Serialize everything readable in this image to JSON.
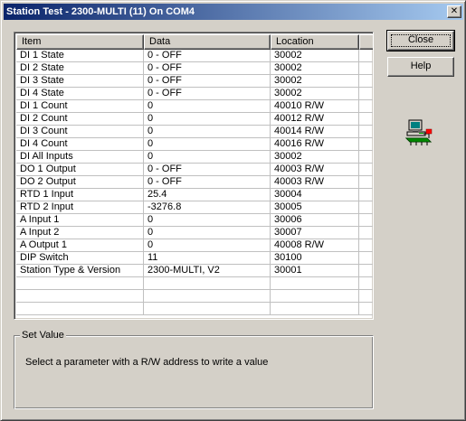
{
  "window": {
    "title": "Station Test - 2300-MULTI (11) On COM4",
    "close_glyph": "✕"
  },
  "table": {
    "columns": [
      "Item",
      "Data",
      "Location"
    ],
    "rows": [
      [
        "DI 1 State",
        "0 - OFF",
        "30002"
      ],
      [
        "DI 2 State",
        "0 - OFF",
        "30002"
      ],
      [
        "DI 3 State",
        "0 - OFF",
        "30002"
      ],
      [
        "DI 4 State",
        "0 - OFF",
        "30002"
      ],
      [
        "DI 1 Count",
        "0",
        "40010 R/W"
      ],
      [
        "DI 2 Count",
        "0",
        "40012 R/W"
      ],
      [
        "DI 3 Count",
        "0",
        "40014 R/W"
      ],
      [
        "DI 4 Count",
        "0",
        "40016 R/W"
      ],
      [
        "DI All Inputs",
        "0",
        "30002"
      ],
      [
        "DO 1 Output",
        "0 - OFF",
        "40003 R/W"
      ],
      [
        "DO 2 Output",
        "0 - OFF",
        "40003 R/W"
      ],
      [
        "RTD 1 Input",
        "25.4",
        "30004"
      ],
      [
        "RTD 2 Input",
        "-3276.8",
        "30005"
      ],
      [
        "A Input 1",
        "0",
        "30006"
      ],
      [
        "A Input 2",
        "0",
        "30007"
      ],
      [
        "A Output 1",
        "0",
        "40008 R/W"
      ],
      [
        "DIP Switch",
        "11",
        "30100"
      ],
      [
        "Station Type & Version",
        "2300-MULTI, V2",
        "30001"
      ]
    ],
    "empty_rows": 3
  },
  "buttons": {
    "close_label": "Close",
    "help_label": "Help"
  },
  "icons": {
    "station": "computer-network-icon"
  },
  "set_value": {
    "legend": "Set Value",
    "message": "Select a parameter with a R/W address to write a value"
  }
}
